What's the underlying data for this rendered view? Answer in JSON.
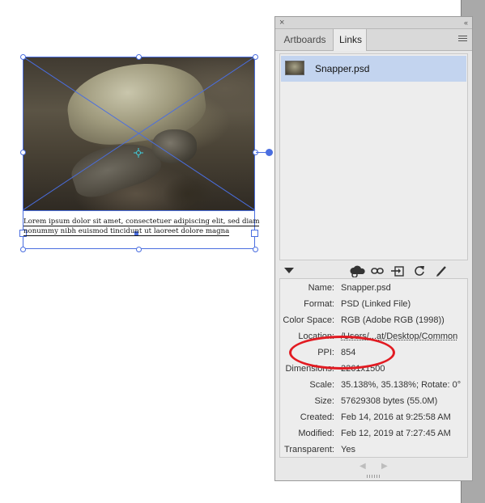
{
  "canvas": {
    "caption_lines": [
      "Lorem ipsum dolor sit amet, consectetuer adipiscing elit, sed diam",
      "nonummy nibh euismod tincidunt ut laoreet dolore magna"
    ],
    "frame_color": "#4a6ee0"
  },
  "panel": {
    "close_glyph": "×",
    "collapse_glyph": "‹‹",
    "tabs": [
      {
        "label": "Artboards",
        "active": false
      },
      {
        "label": "Links",
        "active": true
      }
    ],
    "links": [
      {
        "name": "Snapper.psd",
        "selected": true
      }
    ],
    "toolbar_icons": [
      "disclosure-triangle-icon",
      "cloud-link-icon",
      "relink-icon",
      "go-to-link-icon",
      "update-link-icon",
      "edit-original-icon"
    ],
    "info": [
      {
        "label": "Name:",
        "value": "Snapper.psd"
      },
      {
        "label": "Format:",
        "value": "PSD (Linked File)"
      },
      {
        "label": "Color Space:",
        "value": "RGB (Adobe RGB (1998))"
      },
      {
        "label": "Location:",
        "value": "/Users/...at/Desktop/Common"
      },
      {
        "label": "PPI:",
        "value": "854"
      },
      {
        "label": "Dimensions:",
        "value": "2261x1500"
      },
      {
        "label": "Scale:",
        "value": "35.138%, 35.138%; Rotate: 0°"
      },
      {
        "label": "Size:",
        "value": "57629308 bytes (55.0M)"
      },
      {
        "label": "Created:",
        "value": "Feb 14, 2016 at 9:25:58 AM"
      },
      {
        "label": "Modified:",
        "value": "Feb 12, 2019 at 7:27:45 AM"
      },
      {
        "label": "Transparent:",
        "value": "Yes"
      }
    ],
    "selection_color": "#c3d4ef",
    "highlight_color": "#e21b22"
  }
}
